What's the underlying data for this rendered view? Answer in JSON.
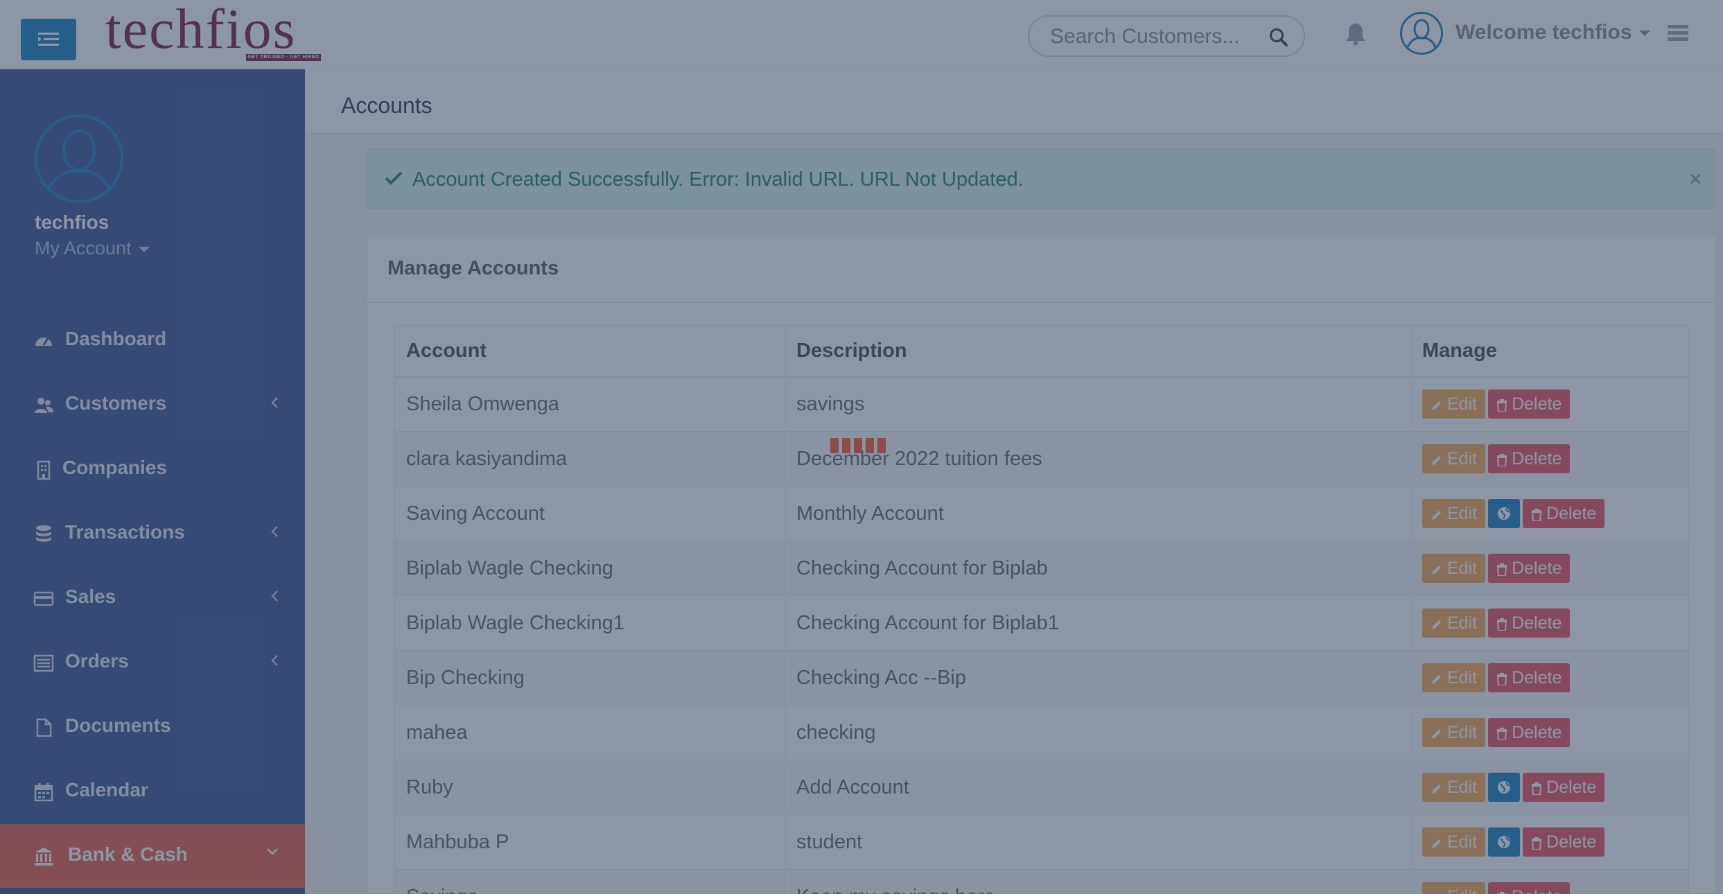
{
  "header": {
    "logo_text": "techfios",
    "logo_tagline": "GET TRAINED · GET HIRED",
    "search_placeholder": "Search Customers...",
    "welcome": "Welcome techfios"
  },
  "sidebar": {
    "username": "techfios",
    "my_account": "My Account",
    "items": [
      {
        "label": "Dashboard",
        "icon": "dashboard-icon"
      },
      {
        "label": "Customers",
        "icon": "users-icon"
      },
      {
        "label": "Companies",
        "icon": "building-icon"
      },
      {
        "label": "Transactions",
        "icon": "database-icon"
      },
      {
        "label": "Sales",
        "icon": "credit-card-icon"
      },
      {
        "label": "Orders",
        "icon": "list-icon"
      },
      {
        "label": "Documents",
        "icon": "file-icon"
      },
      {
        "label": "Calendar",
        "icon": "calendar-icon"
      },
      {
        "label": "Bank & Cash",
        "icon": "bank-icon"
      }
    ]
  },
  "page": {
    "title": "Accounts",
    "alert": "Account Created Successfully. Error: Invalid URL. URL Not Updated.",
    "panel_title": "Manage Accounts"
  },
  "table": {
    "headers": [
      "Account",
      "Description",
      "Manage"
    ],
    "edit_label": "Edit",
    "delete_label": "Delete",
    "rows": [
      {
        "account": "Sheila Omwenga",
        "description": "savings",
        "globe": false
      },
      {
        "account": "clara kasiyandima",
        "description": "December 2022 tuition fees",
        "globe": false
      },
      {
        "account": "Saving Account",
        "description": "Monthly Account",
        "globe": true
      },
      {
        "account": "Biplab Wagle Checking",
        "description": "Checking Account for Biplab",
        "globe": false
      },
      {
        "account": "Biplab Wagle Checking1",
        "description": "Checking Account for Biplab1",
        "globe": false
      },
      {
        "account": "Bip Checking",
        "description": "Checking Acc --Bip",
        "globe": false
      },
      {
        "account": "mahea",
        "description": "checking",
        "globe": false
      },
      {
        "account": "Ruby",
        "description": "Add Account",
        "globe": true
      },
      {
        "account": "Mahbuba P",
        "description": "student",
        "globe": true
      },
      {
        "account": "Savings",
        "description": "Keep my savings here",
        "globe": false
      }
    ]
  },
  "colors": {
    "sidebar": "#3c5a99",
    "active_nav": "#e8624e",
    "edit": "#f8ac59",
    "delete": "#ed5565",
    "globe": "#1c84c6",
    "overlay": "rgba(47,64,90,0.55)"
  }
}
